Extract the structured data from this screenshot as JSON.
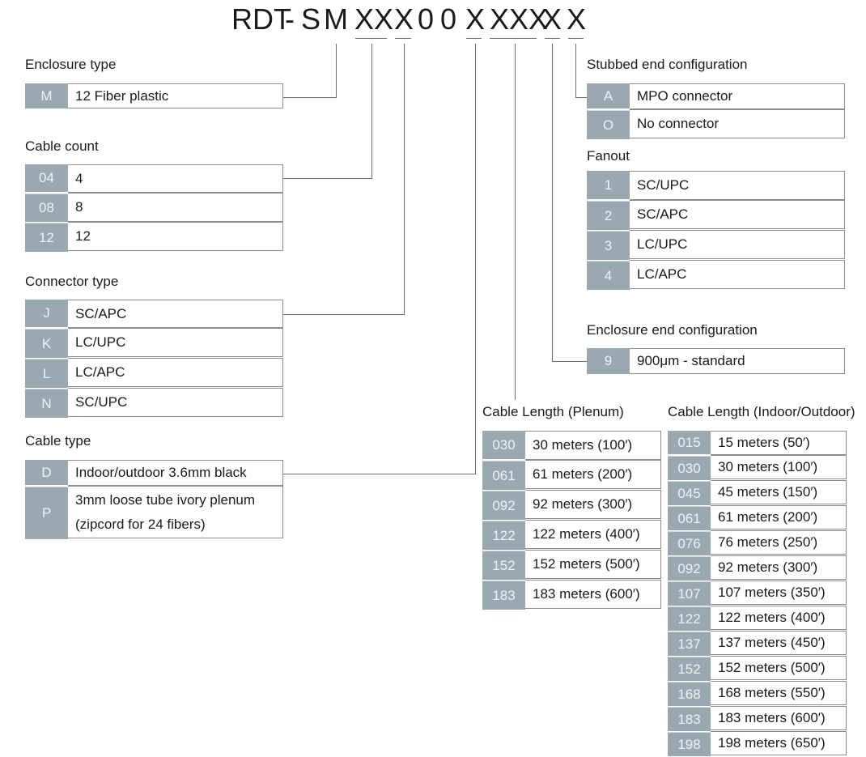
{
  "part_number": {
    "segments": [
      "RDT",
      "-",
      "S",
      "M",
      "XX",
      "X",
      "0",
      "0",
      "X",
      "XXX",
      "X",
      "X"
    ]
  },
  "sections": {
    "enclosure_type": {
      "title": "Enclosure type",
      "rows": [
        {
          "code": "M",
          "desc": "12 Fiber plastic"
        }
      ]
    },
    "cable_count": {
      "title": "Cable count",
      "rows": [
        {
          "code": "04",
          "desc": "4"
        },
        {
          "code": "08",
          "desc": "8"
        },
        {
          "code": "12",
          "desc": "12"
        }
      ]
    },
    "connector_type": {
      "title": "Connector type",
      "rows": [
        {
          "code": "J",
          "desc": "SC/APC"
        },
        {
          "code": "K",
          "desc": "LC/UPC"
        },
        {
          "code": "L",
          "desc": "LC/APC"
        },
        {
          "code": "N",
          "desc": "SC/UPC"
        }
      ]
    },
    "cable_type": {
      "title": "Cable type",
      "rows": [
        {
          "code": "D",
          "desc": "Indoor/outdoor 3.6mm black"
        },
        {
          "code": "P",
          "desc": "3mm loose tube ivory plenum",
          "desc2": "(zipcord for 24 fibers)"
        }
      ]
    },
    "stubbed_end": {
      "title": "Stubbed end configuration",
      "rows": [
        {
          "code": "A",
          "desc": "MPO connector"
        },
        {
          "code": "O",
          "desc": "No connector"
        }
      ]
    },
    "fanout": {
      "title": "Fanout",
      "rows": [
        {
          "code": "1",
          "desc": "SC/UPC"
        },
        {
          "code": "2",
          "desc": "SC/APC"
        },
        {
          "code": "3",
          "desc": "LC/UPC"
        },
        {
          "code": "4",
          "desc": "LC/APC"
        }
      ]
    },
    "enclosure_end": {
      "title": "Enclosure end configuration",
      "rows": [
        {
          "code": "9",
          "desc": "900μm - standard"
        }
      ]
    },
    "cable_length_plenum": {
      "title": "Cable Length (Plenum)",
      "rows": [
        {
          "code": "030",
          "desc": "30 meters (100′)"
        },
        {
          "code": "061",
          "desc": "61 meters (200′)"
        },
        {
          "code": "092",
          "desc": "92 meters (300′)"
        },
        {
          "code": "122",
          "desc": "122 meters (400′)"
        },
        {
          "code": "152",
          "desc": "152 meters (500′)"
        },
        {
          "code": "183",
          "desc": "183 meters (600′)"
        }
      ]
    },
    "cable_length_indoor_outdoor": {
      "title": "Cable Length (Indoor/Outdoor)",
      "rows": [
        {
          "code": "015",
          "desc": "15 meters (50′)"
        },
        {
          "code": "030",
          "desc": "30 meters (100′)"
        },
        {
          "code": "045",
          "desc": "45 meters (150′)"
        },
        {
          "code": "061",
          "desc": "61 meters (200′)"
        },
        {
          "code": "076",
          "desc": "76 meters (250′)"
        },
        {
          "code": "092",
          "desc": "92 meters (300′)"
        },
        {
          "code": "107",
          "desc": "107 meters (350′)"
        },
        {
          "code": "122",
          "desc": "122 meters (400′)"
        },
        {
          "code": "137",
          "desc": "137 meters (450′)"
        },
        {
          "code": "152",
          "desc": "152 meters (500′)"
        },
        {
          "code": "168",
          "desc": "168 meters (550′)"
        },
        {
          "code": "183",
          "desc": "183 meters (600′)"
        },
        {
          "code": "198",
          "desc": "198 meters (650′)"
        }
      ]
    }
  },
  "colors": {
    "code_cell": "#9aa8b2",
    "code_text": "#eef1f3",
    "border": "#8c8c8c",
    "connector_line": "#6e6e6e"
  }
}
